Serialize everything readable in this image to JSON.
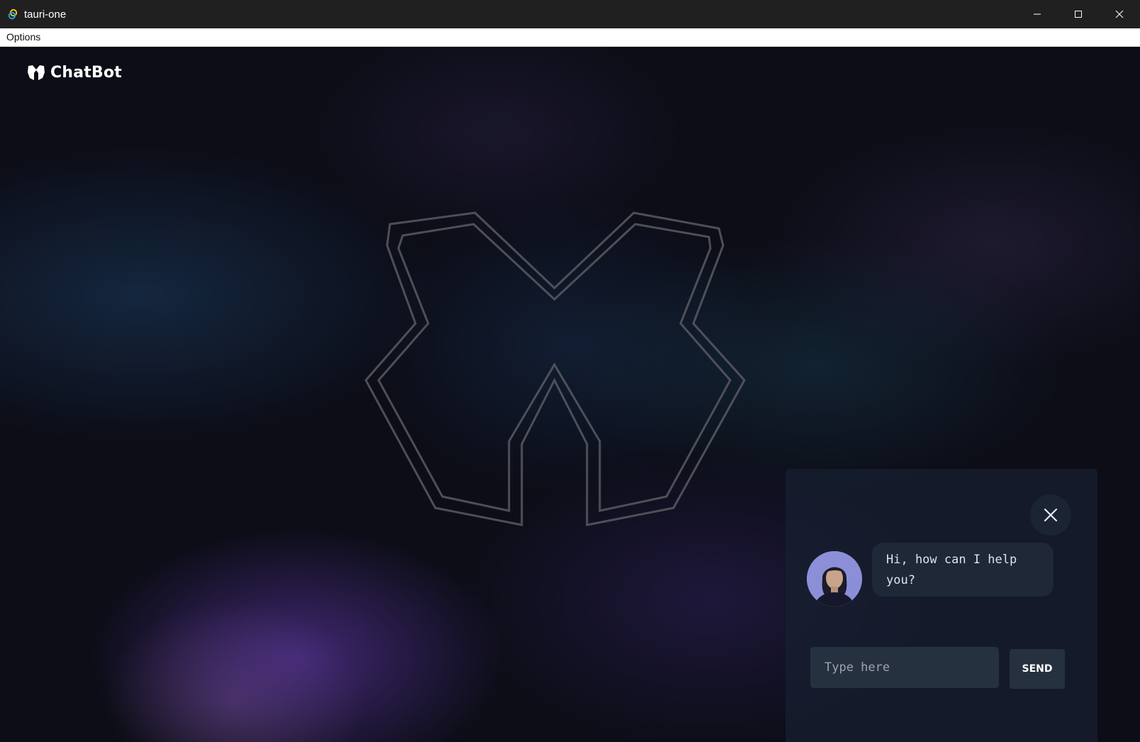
{
  "window": {
    "title": "tauri-one",
    "controls": {
      "minimize_icon": "minimize-icon",
      "maximize_icon": "maximize-icon",
      "close_icon": "close-icon"
    }
  },
  "menubar": {
    "items": [
      {
        "label": "Options"
      }
    ]
  },
  "brand": {
    "name": "ChatBot",
    "icon": "chatbot-logo-icon"
  },
  "background": {
    "logo": "chatbot-logo-outline",
    "colors": {
      "base": "#0c0d17",
      "purple": "#6c3ebe",
      "teal": "#1e466e"
    }
  },
  "chat": {
    "close_icon": "close-icon",
    "avatar": "assistant-avatar",
    "messages": [
      {
        "from": "bot",
        "text": "Hi, how can I help you?"
      }
    ],
    "input": {
      "placeholder": "Type here",
      "value": ""
    },
    "send_label": "SEND"
  }
}
